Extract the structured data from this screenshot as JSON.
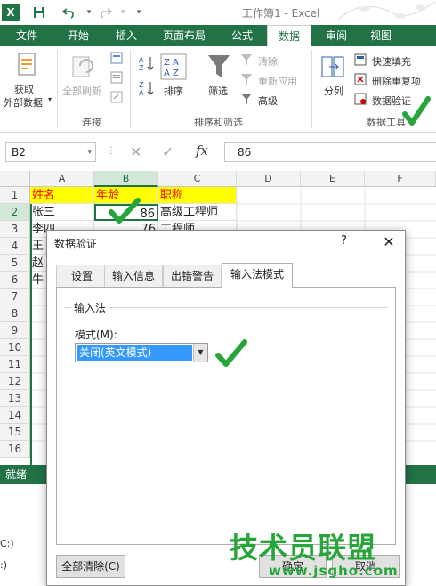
{
  "app": {
    "title": "工作簿1 - Excel",
    "file_icon_label": "X"
  },
  "tabs": [
    "文件",
    "开始",
    "插入",
    "页面布局",
    "公式",
    "数据",
    "审阅",
    "视图"
  ],
  "active_tab": "数据",
  "ribbon": {
    "get_external_data": [
      "获取",
      "外部数据"
    ],
    "refresh_all": "全部刷新",
    "connections_group": "连接",
    "sort": "排序",
    "filter": "筛选",
    "clear": "清除",
    "reapply": "重新应用",
    "advanced": "高级",
    "sort_filter_group": "排序和筛选",
    "text_to_columns": "分列",
    "flash_fill": "快速填充",
    "remove_duplicates": "删除重复项",
    "data_validation": "数据验证",
    "data_tools_group": "数据工具"
  },
  "formula_bar": {
    "name_box": "B2",
    "fx": "fx",
    "value": "86"
  },
  "grid": {
    "columns": [
      "A",
      "B",
      "C",
      "D",
      "E",
      "F"
    ],
    "rows": [
      "1",
      "2",
      "3",
      "4",
      "5",
      "6",
      "7",
      "8",
      "9",
      "10",
      "11",
      "12",
      "13",
      "14",
      "15",
      "16"
    ],
    "header_row": [
      "姓名",
      "年龄",
      "职称"
    ],
    "data_rows": [
      [
        "张三",
        "86",
        "高级工程师"
      ],
      [
        "李四",
        "76",
        "工程师"
      ],
      [
        "王",
        "",
        ""
      ],
      [
        "赵",
        "",
        ""
      ],
      [
        "牛",
        "",
        ""
      ]
    ]
  },
  "status": "就绪",
  "lower_fragments": [
    "C:)",
    ":)"
  ],
  "dialog": {
    "title": "数据验证",
    "help": "?",
    "close": "✕",
    "tabs": [
      "设置",
      "输入信息",
      "出错警告",
      "输入法模式"
    ],
    "active_tab": "输入法模式",
    "group_title": "输入法",
    "mode_label": "模式(M):",
    "mode_value": "关闭(英文模式)",
    "clear_all": "全部清除(C)",
    "ok": "确定",
    "cancel": "取消"
  },
  "watermark": {
    "logo": "技术员联盟",
    "url": "www.jsgho.com"
  },
  "colors": {
    "excel_green": "#217346",
    "check_green": "#27a53a",
    "header_fill": "#ffff00",
    "header_text": "#ff0000",
    "selection_blue": "#3399ff"
  }
}
